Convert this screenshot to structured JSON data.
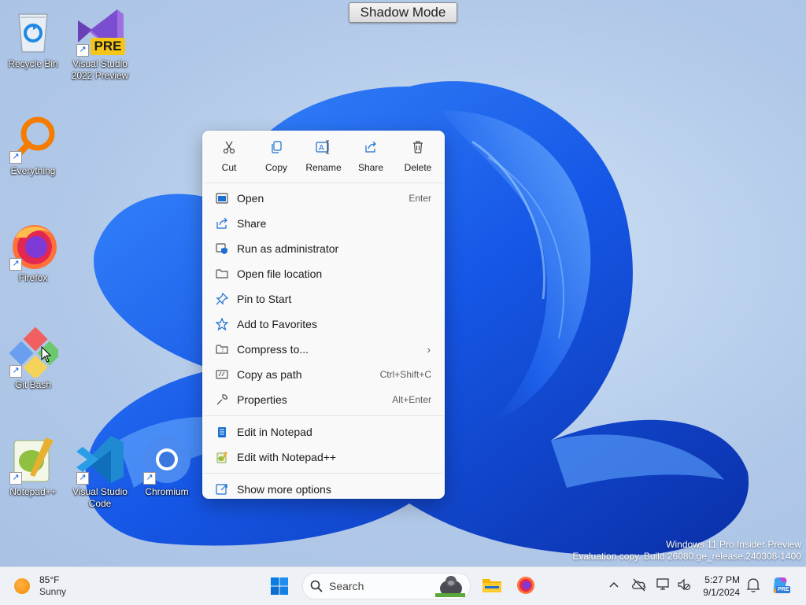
{
  "shadow_mode": {
    "label": "Shadow Mode"
  },
  "desktop_icons": [
    {
      "label": "Recycle Bin"
    },
    {
      "label": "Visual Studio 2022 Preview",
      "badge": "PRE"
    },
    {
      "label": "Everything"
    },
    {
      "label": "Firefox"
    },
    {
      "label": "Git Bash"
    },
    {
      "label": "Notepad++"
    },
    {
      "label": "Visual Studio Code"
    },
    {
      "label": "Chromium"
    }
  ],
  "context_menu": {
    "top_actions": [
      {
        "label": "Cut",
        "icon": "scissors-icon"
      },
      {
        "label": "Copy",
        "icon": "copy-icon"
      },
      {
        "label": "Rename",
        "icon": "rename-icon"
      },
      {
        "label": "Share",
        "icon": "share-icon"
      },
      {
        "label": "Delete",
        "icon": "trash-icon"
      }
    ],
    "items": [
      {
        "label": "Open",
        "shortcut": "Enter"
      },
      {
        "label": "Share",
        "shortcut": ""
      },
      {
        "label": "Run as administrator",
        "shortcut": ""
      },
      {
        "label": "Open file location",
        "shortcut": ""
      },
      {
        "label": "Pin to Start",
        "shortcut": ""
      },
      {
        "label": "Add to Favorites",
        "shortcut": ""
      },
      {
        "label": "Compress to...",
        "shortcut": ""
      },
      {
        "label": "Copy as path",
        "shortcut": "Ctrl+Shift+C"
      },
      {
        "label": "Properties",
        "shortcut": "Alt+Enter"
      },
      {
        "label": "Edit in Notepad",
        "shortcut": ""
      },
      {
        "label": "Edit with Notepad++",
        "shortcut": ""
      },
      {
        "label": "Show more options",
        "shortcut": ""
      }
    ]
  },
  "watermark": {
    "line1": "Windows 11 Pro Insider Preview",
    "line2": "Evaluation copy. Build 26080.ge_release.240308-1400"
  },
  "taskbar": {
    "weather_temp": "85°F",
    "weather_desc": "Sunny",
    "search_placeholder": "Search",
    "time": "5:27 PM",
    "date": "9/1/2024"
  },
  "colors": {
    "accent": "#0067c0",
    "wallpaper_blue": "#1a5ee0"
  }
}
